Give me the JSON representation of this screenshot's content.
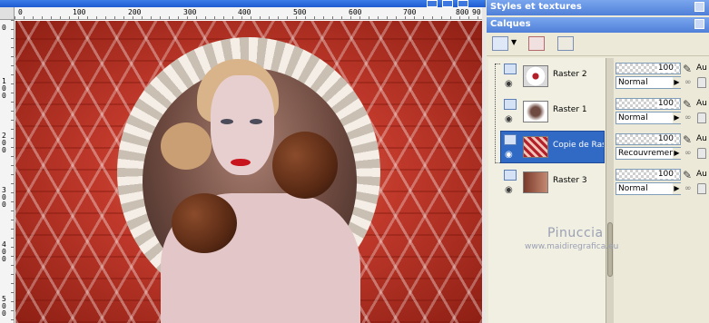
{
  "canvas": {
    "ruler_top_ticks": [
      "0",
      "100",
      "200",
      "300",
      "400",
      "500",
      "600",
      "700",
      "800",
      "90"
    ],
    "ruler_left_ticks": [
      "0",
      "100",
      "200",
      "300",
      "400",
      "500"
    ]
  },
  "watermark": {
    "name": "Pinuccia",
    "url": "www.maidiregrafica.eu"
  },
  "panels": {
    "styles_title": "Styles et textures",
    "layers_title": "Calques"
  },
  "layers": [
    {
      "name": "Raster 2",
      "opacity": "100",
      "blend": "Normal",
      "auto": "Au",
      "selected": false
    },
    {
      "name": "Raster 1",
      "opacity": "100",
      "blend": "Normal",
      "auto": "Au",
      "selected": false
    },
    {
      "name": "Copie de Rast",
      "opacity": "100",
      "blend": "Recouvrement",
      "auto": "Au",
      "selected": true
    },
    {
      "name": "Raster 3",
      "opacity": "100",
      "blend": "Normal",
      "auto": "Au",
      "selected": false
    }
  ],
  "icons": {
    "visibility": "eye-icon",
    "brush": "brush-icon",
    "new_layer": "new-layer-icon",
    "delete_layer": "delete-layer-icon",
    "edit_layer": "edit-layer-icon"
  },
  "colors": {
    "title_bar": "#1f5cd1",
    "panel_header": "#4f7fd8",
    "selected_layer": "#316ac5",
    "panel_bg": "#ece9d8"
  }
}
